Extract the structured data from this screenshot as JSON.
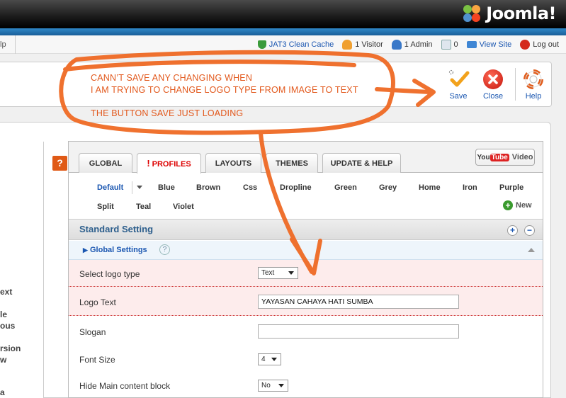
{
  "header": {
    "brand": "Joomla!"
  },
  "statusbar": {
    "left_tab": "lp",
    "items": [
      {
        "label": "JAT3 Clean Cache",
        "icon": "cache-icon"
      },
      {
        "label": "1 Visitor",
        "icon": "visitor-icon"
      },
      {
        "label": "1 Admin",
        "icon": "admin-icon"
      },
      {
        "label": "0",
        "icon": "message-icon"
      },
      {
        "label": "View Site",
        "icon": "view-site-icon"
      },
      {
        "label": "Log out",
        "icon": "logout-icon"
      }
    ]
  },
  "toolbar": {
    "save": "Save",
    "close": "Close",
    "help": "Help"
  },
  "annotation": {
    "line1": "CANN’T SAVE ANY CHANGING WHEN",
    "line2": "I AM TRYING TO CHANGE LOGO TYPE FROM IMAGE TO TEXT",
    "line3": "THE BUTTON SAVE JUST LOADING"
  },
  "left_column": [
    "ext",
    "le",
    "ous",
    "rsion",
    "w",
    "a"
  ],
  "tabs": [
    "GLOBAL",
    "PROFILES",
    "LAYOUTS",
    "THEMES",
    "UPDATE & HELP"
  ],
  "video_button": {
    "yt_a": "You",
    "yt_b": "Tube",
    "label": "Video"
  },
  "profiles": [
    "Default",
    "Blue",
    "Brown",
    "Css",
    "Dropline",
    "Green",
    "Grey",
    "Home",
    "Iron",
    "Purple",
    "Split",
    "Teal",
    "Violet"
  ],
  "new_label": "New",
  "section": {
    "title": "Standard Setting",
    "group": "Global Settings",
    "help": "?"
  },
  "help_badge": "?",
  "fields": [
    {
      "label": "Select logo type",
      "value": "Text"
    },
    {
      "label": "Logo Text",
      "value": "YAYASAN CAHAYA HATI SUMBA"
    },
    {
      "label": "Slogan",
      "value": ""
    },
    {
      "label": "Font Size",
      "value": "4"
    },
    {
      "label": "Hide Main content block",
      "value": "No"
    }
  ],
  "colors": {
    "accent": "#1b57b1",
    "annotation": "#e2581c",
    "highlight_row": "#fdecec"
  }
}
